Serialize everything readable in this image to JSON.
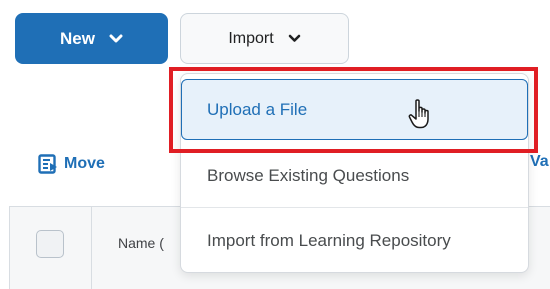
{
  "toolbar": {
    "new_label": "New",
    "import_label": "Import"
  },
  "import_menu": {
    "items": [
      {
        "label": "Upload a File",
        "highlighted": true
      },
      {
        "label": "Browse Existing Questions"
      },
      {
        "label": "Import from Learning Repository"
      }
    ]
  },
  "actions": {
    "move_label": "Move",
    "partial_label": "Va"
  },
  "table": {
    "name_header": "Name ("
  },
  "colors": {
    "accent": "#1f6fb6",
    "highlight": "#e01e24"
  },
  "icons": {
    "chevron": "chevron-down-icon",
    "move": "move-icon",
    "cursor": "hand-pointer-icon"
  }
}
